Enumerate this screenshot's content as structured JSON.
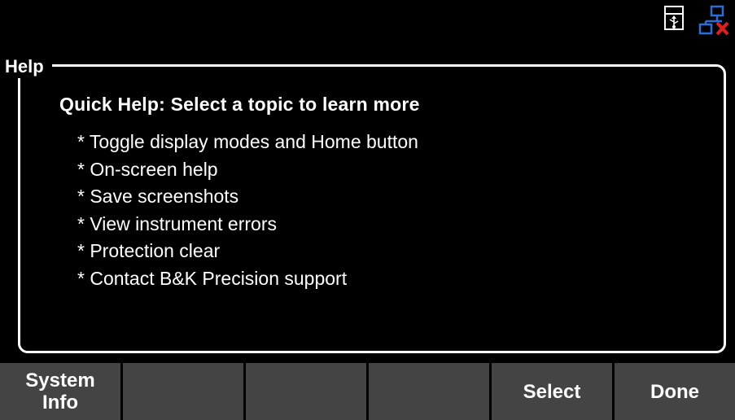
{
  "status_icons": {
    "usb": "usb-storage-icon",
    "lan": "lan-disconnected-icon"
  },
  "help": {
    "title": "Help",
    "heading": "Quick Help: Select a topic to learn more",
    "topics": [
      "* Toggle display modes and Home button",
      "* On-screen help",
      "* Save screenshots",
      "* View instrument errors",
      "* Protection clear",
      "* Contact B&K Precision support"
    ]
  },
  "softkeys": [
    {
      "label": "System\nInfo"
    },
    {
      "label": ""
    },
    {
      "label": ""
    },
    {
      "label": ""
    },
    {
      "label": "Select"
    },
    {
      "label": "Done"
    }
  ],
  "colors": {
    "background": "#000000",
    "foreground": "#ffffff",
    "softkey": "#444444",
    "lan_blue": "#2b6fd6",
    "lan_error": "#e0201a"
  }
}
